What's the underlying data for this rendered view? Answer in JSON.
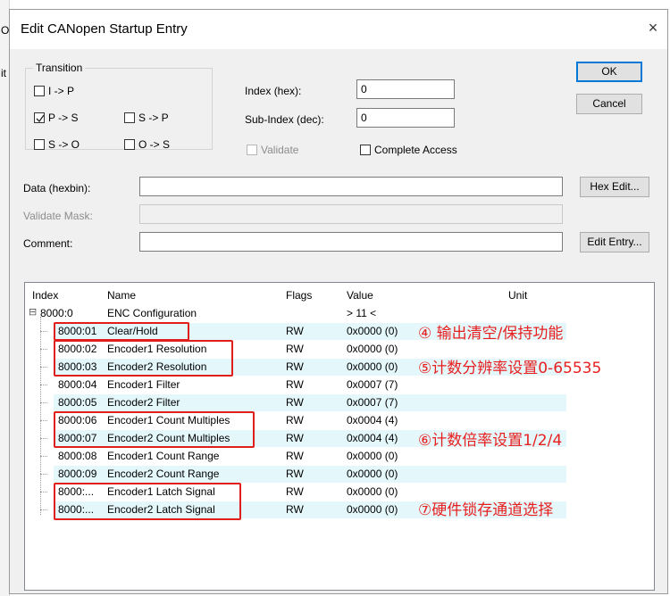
{
  "background_fragments": [
    "O",
    "it"
  ],
  "window": {
    "title": "Edit CANopen Startup Entry",
    "close_symbol": "×"
  },
  "transition": {
    "group_label": "Transition",
    "options": [
      {
        "label": "I -> P",
        "checked": false
      },
      {
        "label": "P -> S",
        "checked": true
      },
      {
        "label": "S -> P",
        "checked": false
      },
      {
        "label": "S -> O",
        "checked": false
      },
      {
        "label": "O -> S",
        "checked": false
      }
    ]
  },
  "fields": {
    "index_label": "Index (hex):",
    "index_value": "0",
    "subindex_label": "Sub-Index (dec):",
    "subindex_value": "0",
    "validate_label": "Validate",
    "complete_access_label": "Complete Access",
    "data_label": "Data (hexbin):",
    "data_value": "",
    "validate_mask_label": "Validate Mask:",
    "validate_mask_value": "",
    "comment_label": "Comment:",
    "comment_value": ""
  },
  "buttons": {
    "ok": "OK",
    "cancel": "Cancel",
    "hex_edit": "Hex Edit...",
    "edit_entry": "Edit Entry..."
  },
  "table": {
    "headers": {
      "index": "Index",
      "name": "Name",
      "flags": "Flags",
      "value": "Value",
      "unit": "Unit"
    },
    "expander": "⊟",
    "rows": [
      {
        "index": "8000:0",
        "name": "ENC Configuration",
        "flags": "",
        "value": "> 11 <",
        "unit": ""
      },
      {
        "index": "8000:01",
        "name": "Clear/Hold",
        "flags": "RW",
        "value": "0x0000 (0)",
        "unit": ""
      },
      {
        "index": "8000:02",
        "name": "Encoder1 Resolution",
        "flags": "RW",
        "value": "0x0000 (0)",
        "unit": ""
      },
      {
        "index": "8000:03",
        "name": "Encoder2 Resolution",
        "flags": "RW",
        "value": "0x0000 (0)",
        "unit": ""
      },
      {
        "index": "8000:04",
        "name": "Encoder1 Filter",
        "flags": "RW",
        "value": "0x0007 (7)",
        "unit": ""
      },
      {
        "index": "8000:05",
        "name": "Encoder2 Filter",
        "flags": "RW",
        "value": "0x0007 (7)",
        "unit": ""
      },
      {
        "index": "8000:06",
        "name": "Encoder1 Count Multiples",
        "flags": "RW",
        "value": "0x0004 (4)",
        "unit": ""
      },
      {
        "index": "8000:07",
        "name": "Encoder2 Count Multiples",
        "flags": "RW",
        "value": "0x0004 (4)",
        "unit": ""
      },
      {
        "index": "8000:08",
        "name": "Encoder1 Count Range",
        "flags": "RW",
        "value": "0x0000 (0)",
        "unit": ""
      },
      {
        "index": "8000:09",
        "name": "Encoder2 Count Range",
        "flags": "RW",
        "value": "0x0000 (0)",
        "unit": ""
      },
      {
        "index": "8000:...",
        "name": "Encoder1 Latch Signal",
        "flags": "RW",
        "value": "0x0000 (0)",
        "unit": ""
      },
      {
        "index": "8000:...",
        "name": "Encoder2 Latch Signal",
        "flags": "RW",
        "value": "0x0000 (0)",
        "unit": ""
      }
    ]
  },
  "annotations": [
    {
      "text": "④ 输出清空/保持功能",
      "color": "#e81f1f"
    },
    {
      "text": "⑤计数分辨率设置0-65535",
      "color": "#e81f1f"
    },
    {
      "text": "⑥计数倍率设置1/2/4",
      "color": "#e81f1f"
    },
    {
      "text": "⑦硬件锁存通道选择",
      "color": "#e81f1f"
    }
  ],
  "colors": {
    "accent": "#0078d7",
    "highlight": "#e01e1e",
    "row_shade": "#e4f7fa"
  }
}
